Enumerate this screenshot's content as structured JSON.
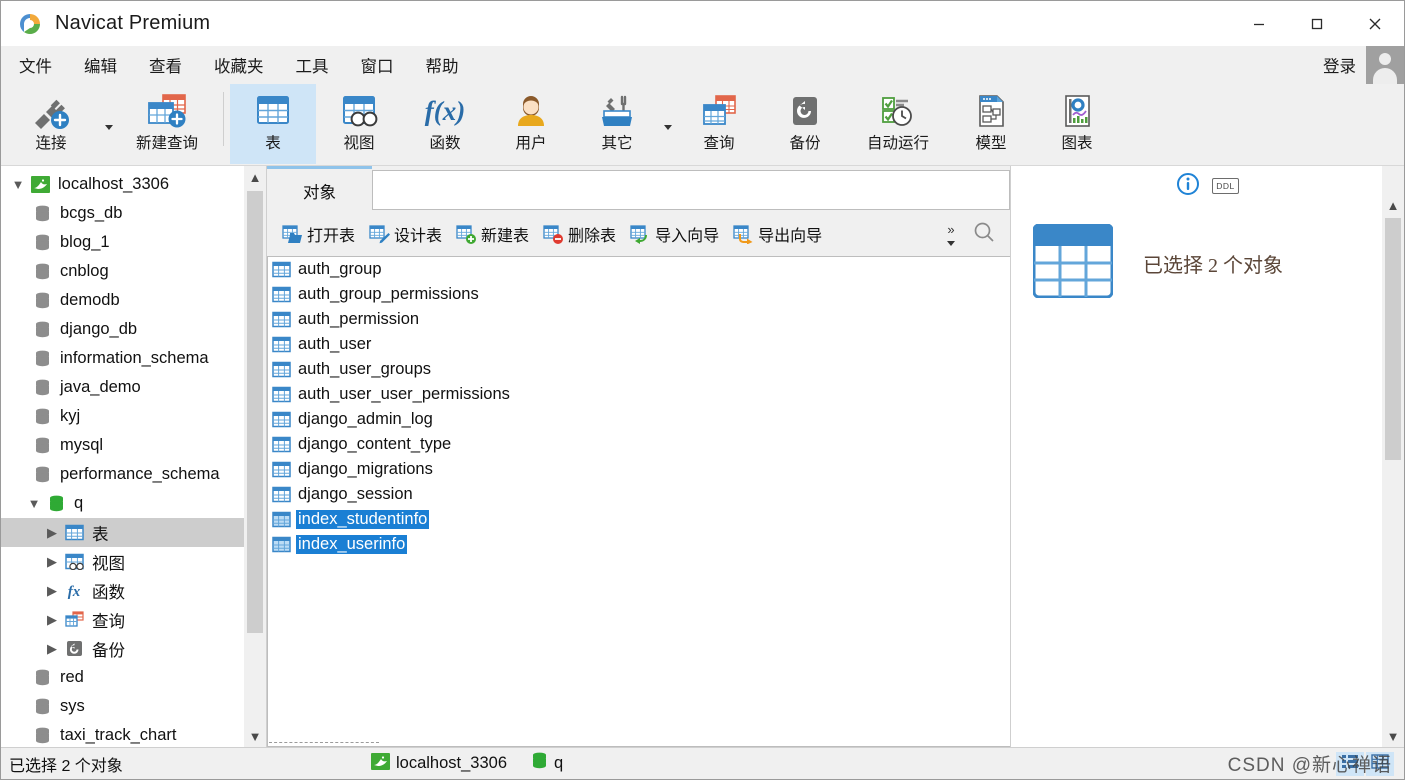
{
  "window": {
    "title": "Navicat Premium",
    "logo_icon": "navicat-logo-icon",
    "minimize_label": "—",
    "maximize_label": "□",
    "close_label": "✕"
  },
  "menubar": {
    "items": [
      {
        "label": "文件",
        "name": "menu-file"
      },
      {
        "label": "编辑",
        "name": "menu-edit"
      },
      {
        "label": "查看",
        "name": "menu-view"
      },
      {
        "label": "收藏夹",
        "name": "menu-favorites"
      },
      {
        "label": "工具",
        "name": "menu-tools"
      },
      {
        "label": "窗口",
        "name": "menu-window"
      },
      {
        "label": "帮助",
        "name": "menu-help"
      }
    ],
    "login_label": "登录"
  },
  "toolbar": {
    "items": [
      {
        "label": "连接",
        "icon": "connection-plug-icon",
        "active": false,
        "has_caret": true
      },
      {
        "label": "新建查询",
        "icon": "new-query-icon",
        "active": false,
        "has_caret": false
      },
      {
        "label": "表",
        "icon": "table-icon",
        "active": true,
        "has_caret": false
      },
      {
        "label": "视图",
        "icon": "view-icon",
        "active": false,
        "has_caret": false
      },
      {
        "label": "函数",
        "icon": "function-fx-icon",
        "active": false,
        "has_caret": false
      },
      {
        "label": "用户",
        "icon": "user-icon",
        "active": false,
        "has_caret": false
      },
      {
        "label": "其它",
        "icon": "other-toolbox-icon",
        "active": false,
        "has_caret": true
      },
      {
        "label": "查询",
        "icon": "query-icon",
        "active": false,
        "has_caret": false
      },
      {
        "label": "备份",
        "icon": "backup-icon",
        "active": false,
        "has_caret": false
      },
      {
        "label": "自动运行",
        "icon": "automation-icon",
        "active": false,
        "has_caret": false
      },
      {
        "label": "模型",
        "icon": "model-icon",
        "active": false,
        "has_caret": false
      },
      {
        "label": "图表",
        "icon": "chart-icon",
        "active": false,
        "has_caret": false
      }
    ]
  },
  "sidebar": {
    "connection": {
      "label": "localhost_3306",
      "icon": "mysql-dolphin-icon",
      "expanded": true
    },
    "databases": [
      {
        "label": "bcgs_db",
        "icon": "database-icon",
        "active": false
      },
      {
        "label": "blog_1",
        "icon": "database-icon",
        "active": false
      },
      {
        "label": "cnblog",
        "icon": "database-icon",
        "active": false
      },
      {
        "label": "demodb",
        "icon": "database-icon",
        "active": false
      },
      {
        "label": "django_db",
        "icon": "database-icon",
        "active": false
      },
      {
        "label": "information_schema",
        "icon": "database-icon",
        "active": false
      },
      {
        "label": "java_demo",
        "icon": "database-icon",
        "active": false
      },
      {
        "label": "kyj",
        "icon": "database-icon",
        "active": false
      },
      {
        "label": "mysql",
        "icon": "database-icon",
        "active": false
      },
      {
        "label": "performance_schema",
        "icon": "database-icon",
        "active": false
      }
    ],
    "open_database": {
      "label": "q",
      "icon": "database-open-icon",
      "expanded": true
    },
    "open_database_children": [
      {
        "label": "表",
        "icon": "table-icon",
        "selected": true
      },
      {
        "label": "视图",
        "icon": "view-icon",
        "selected": false
      },
      {
        "label": "函数",
        "icon": "function-fx-icon",
        "selected": false
      },
      {
        "label": "查询",
        "icon": "query-icon",
        "selected": false
      },
      {
        "label": "备份",
        "icon": "backup-icon",
        "selected": false
      }
    ],
    "databases_after": [
      {
        "label": "red",
        "icon": "database-icon",
        "active": false
      },
      {
        "label": "sys",
        "icon": "database-icon",
        "active": false
      },
      {
        "label": "taxi_track_chart",
        "icon": "database-icon",
        "active": false
      }
    ]
  },
  "center": {
    "tab": {
      "label": "对象",
      "active": true
    },
    "object_toolbar": [
      {
        "label": "打开表",
        "icon": "open-table-icon"
      },
      {
        "label": "设计表",
        "icon": "design-table-icon"
      },
      {
        "label": "新建表",
        "icon": "new-table-icon"
      },
      {
        "label": "删除表",
        "icon": "delete-table-icon"
      },
      {
        "label": "导入向导",
        "icon": "import-wizard-icon"
      },
      {
        "label": "导出向导",
        "icon": "export-wizard-icon"
      }
    ],
    "overflow_label": "»",
    "search_icon": "search-icon",
    "tables": [
      {
        "name": "auth_group",
        "selected": false
      },
      {
        "name": "auth_group_permissions",
        "selected": false
      },
      {
        "name": "auth_permission",
        "selected": false
      },
      {
        "name": "auth_user",
        "selected": false
      },
      {
        "name": "auth_user_groups",
        "selected": false
      },
      {
        "name": "auth_user_user_permissions",
        "selected": false
      },
      {
        "name": "django_admin_log",
        "selected": false
      },
      {
        "name": "django_content_type",
        "selected": false
      },
      {
        "name": "django_migrations",
        "selected": false
      },
      {
        "name": "django_session",
        "selected": false
      },
      {
        "name": "index_studentinfo",
        "selected": true
      },
      {
        "name": "index_userinfo",
        "selected": true
      }
    ]
  },
  "info_panel": {
    "info_icon": "info-circle-icon",
    "ddl_label": "DDL",
    "object_icon": "table-large-icon",
    "summary": "已选择 2 个对象"
  },
  "statusbar": {
    "left_text": "已选择 2 个对象",
    "connection_label": "localhost_3306",
    "connection_icon": "mysql-dolphin-icon",
    "database_label": "q",
    "database_icon": "database-open-icon",
    "view_buttons": [
      {
        "name": "list-view-button",
        "icon": "list-view-icon"
      },
      {
        "name": "detail-view-button",
        "icon": "detail-view-icon"
      }
    ],
    "watermark": "CSDN @新心禅语"
  },
  "colors": {
    "accent_blue": "#3a87c8",
    "selection_blue": "#1a7fd4",
    "toolbar_active": "#cfe5f7",
    "tree_selected": "#cdcdcd",
    "mysql_green": "#3faa35",
    "info_text": "#5b4638"
  }
}
